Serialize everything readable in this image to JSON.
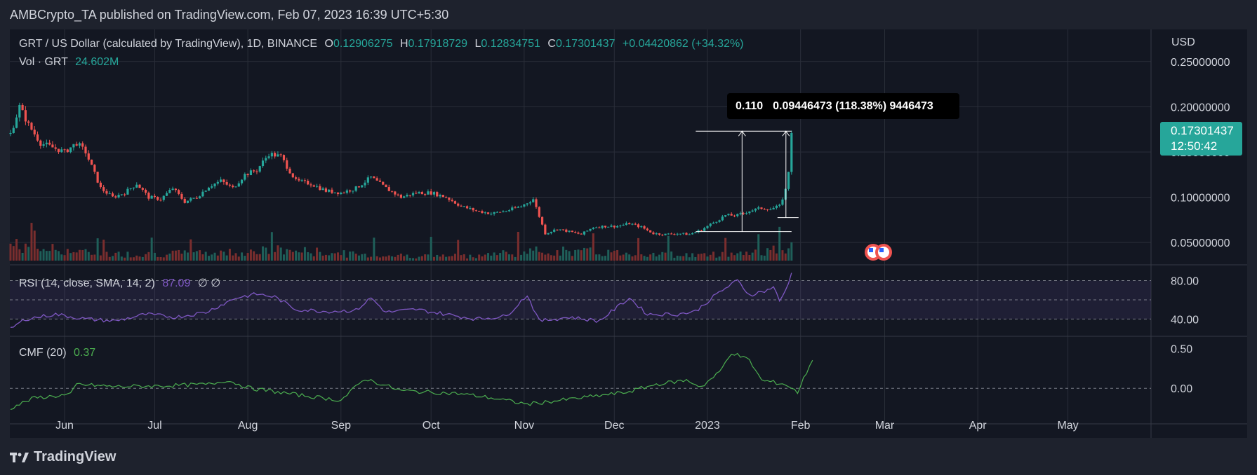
{
  "header": {
    "published_text": "AMBCrypto_TA published on TradingView.com, Feb 07, 2023 16:39 UTC+5:30"
  },
  "legend": {
    "symbol": "GRT / US Dollar (calculated by TradingView), 1D, BINANCE",
    "o_label": "O",
    "o": "0.12906275",
    "h_label": "H",
    "h": "0.17918729",
    "l_label": "L",
    "l": "0.12834751",
    "c_label": "C",
    "c": "0.17301437",
    "change": "+0.04420862 (+34.32%)",
    "vol_label": "Vol · GRT",
    "vol": "24.602M"
  },
  "currency_label": "USD",
  "price_badge": {
    "price": "0.17301437",
    "countdown": "12:50:42"
  },
  "measure": {
    "box_left": "0.110",
    "box_right": "0.09446473 (118.38%) 9446473"
  },
  "rsi": {
    "label": "RSI (14, close, SMA, 14, 2)",
    "value": "87.09",
    "extra": "∅ ∅"
  },
  "cmf": {
    "label": "CMF (20)",
    "value": "0.37"
  },
  "footer": {
    "brand": "TradingView"
  },
  "colors": {
    "bg": "#131722",
    "up": "#26a69a",
    "down": "#ef5350",
    "rsi": "#7e57c2",
    "cmf": "#4caf50",
    "grid": "#2a2e39",
    "text": "#d1d4dc"
  },
  "chart_data": {
    "type": "candlestick",
    "price_axis": [
      "0.25000000",
      "0.20000000",
      "0.15000000",
      "0.10000000",
      "0.05000000"
    ],
    "price_axis_values": [
      0.25,
      0.2,
      0.15,
      0.1,
      0.05
    ],
    "ylim": [
      0.03,
      0.256
    ],
    "rsi_axis": [
      "80.00",
      "40.00"
    ],
    "rsi_axis_values": [
      80,
      40
    ],
    "rsi_ylim": [
      25,
      92
    ],
    "cmf_axis": [
      "0.50",
      "0.00"
    ],
    "cmf_axis_values": [
      0.5,
      0.0
    ],
    "cmf_ylim": [
      -0.35,
      0.6
    ],
    "time_axis": [
      "Jun",
      "Jul",
      "Aug",
      "Sep",
      "Oct",
      "Nov",
      "Dec",
      "2023",
      "Feb",
      "Mar",
      "Apr",
      "May"
    ],
    "time_axis_index": [
      18,
      48,
      79,
      110,
      140,
      171,
      201,
      232,
      263,
      291,
      322,
      352
    ],
    "price_anchors": [
      [
        0,
        0.17
      ],
      [
        3,
        0.2
      ],
      [
        6,
        0.18
      ],
      [
        10,
        0.16
      ],
      [
        14,
        0.155
      ],
      [
        18,
        0.15
      ],
      [
        22,
        0.16
      ],
      [
        25,
        0.15
      ],
      [
        30,
        0.11
      ],
      [
        34,
        0.1
      ],
      [
        38,
        0.105
      ],
      [
        42,
        0.115
      ],
      [
        46,
        0.1
      ],
      [
        50,
        0.098
      ],
      [
        54,
        0.11
      ],
      [
        58,
        0.095
      ],
      [
        62,
        0.1
      ],
      [
        66,
        0.112
      ],
      [
        70,
        0.118
      ],
      [
        74,
        0.11
      ],
      [
        78,
        0.125
      ],
      [
        82,
        0.13
      ],
      [
        86,
        0.148
      ],
      [
        90,
        0.145
      ],
      [
        95,
        0.118
      ],
      [
        100,
        0.115
      ],
      [
        105,
        0.107
      ],
      [
        110,
        0.105
      ],
      [
        115,
        0.11
      ],
      [
        120,
        0.122
      ],
      [
        125,
        0.11
      ],
      [
        130,
        0.1
      ],
      [
        135,
        0.105
      ],
      [
        140,
        0.105
      ],
      [
        145,
        0.1
      ],
      [
        150,
        0.09
      ],
      [
        155,
        0.085
      ],
      [
        160,
        0.082
      ],
      [
        165,
        0.085
      ],
      [
        170,
        0.09
      ],
      [
        174,
        0.098
      ],
      [
        178,
        0.06
      ],
      [
        182,
        0.065
      ],
      [
        186,
        0.062
      ],
      [
        190,
        0.059
      ],
      [
        194,
        0.067
      ],
      [
        198,
        0.068
      ],
      [
        202,
        0.068
      ],
      [
        206,
        0.071
      ],
      [
        210,
        0.067
      ],
      [
        214,
        0.06
      ],
      [
        218,
        0.059
      ],
      [
        222,
        0.06
      ],
      [
        226,
        0.059
      ],
      [
        230,
        0.064
      ],
      [
        234,
        0.072
      ],
      [
        238,
        0.08
      ],
      [
        242,
        0.08
      ],
      [
        246,
        0.085
      ],
      [
        250,
        0.088
      ],
      [
        253,
        0.087
      ],
      [
        256,
        0.09
      ],
      [
        258,
        0.108
      ],
      [
        259,
        0.129
      ],
      [
        260,
        0.173
      ]
    ],
    "volume_anchors": [
      [
        0,
        0.9
      ],
      [
        30,
        0.35
      ],
      [
        60,
        0.4
      ],
      [
        80,
        0.5
      ],
      [
        90,
        0.6
      ],
      [
        120,
        0.3
      ],
      [
        150,
        0.25
      ],
      [
        172,
        0.5
      ],
      [
        180,
        0.55
      ],
      [
        200,
        0.45
      ],
      [
        230,
        0.3
      ],
      [
        245,
        0.45
      ],
      [
        260,
        0.7
      ]
    ],
    "rsi_anchors": [
      [
        0,
        30
      ],
      [
        5,
        40
      ],
      [
        15,
        45
      ],
      [
        25,
        40
      ],
      [
        35,
        38
      ],
      [
        45,
        45
      ],
      [
        55,
        42
      ],
      [
        65,
        47
      ],
      [
        75,
        62
      ],
      [
        82,
        66
      ],
      [
        88,
        63
      ],
      [
        95,
        50
      ],
      [
        105,
        48
      ],
      [
        115,
        49
      ],
      [
        120,
        62
      ],
      [
        125,
        47
      ],
      [
        135,
        50
      ],
      [
        145,
        45
      ],
      [
        155,
        40
      ],
      [
        165,
        43
      ],
      [
        172,
        65
      ],
      [
        176,
        38
      ],
      [
        186,
        42
      ],
      [
        196,
        38
      ],
      [
        206,
        62
      ],
      [
        212,
        45
      ],
      [
        222,
        45
      ],
      [
        228,
        48
      ],
      [
        236,
        68
      ],
      [
        242,
        80
      ],
      [
        246,
        65
      ],
      [
        252,
        70
      ],
      [
        254,
        74
      ],
      [
        256,
        58
      ],
      [
        258,
        70
      ],
      [
        260,
        87
      ]
    ],
    "cmf_anchors": [
      [
        0,
        -0.25
      ],
      [
        8,
        -0.12
      ],
      [
        20,
        -0.08
      ],
      [
        22,
        0.05
      ],
      [
        35,
        0.02
      ],
      [
        50,
        0.03
      ],
      [
        66,
        0.05
      ],
      [
        72,
        0.1
      ],
      [
        80,
        0.0
      ],
      [
        95,
        -0.08
      ],
      [
        110,
        -0.15
      ],
      [
        118,
        0.12
      ],
      [
        130,
        -0.03
      ],
      [
        140,
        -0.05
      ],
      [
        150,
        -0.07
      ],
      [
        160,
        -0.12
      ],
      [
        172,
        -0.2
      ],
      [
        190,
        -0.12
      ],
      [
        205,
        -0.05
      ],
      [
        215,
        0.05
      ],
      [
        225,
        0.1
      ],
      [
        230,
        0.02
      ],
      [
        236,
        0.2
      ],
      [
        240,
        0.45
      ],
      [
        246,
        0.35
      ],
      [
        250,
        0.1
      ],
      [
        258,
        0.05
      ],
      [
        262,
        -0.05
      ],
      [
        265,
        0.2
      ],
      [
        267,
        0.37
      ]
    ],
    "measure_from_index": 244,
    "measure_low": 0.062,
    "measure_high": 0.173
  }
}
